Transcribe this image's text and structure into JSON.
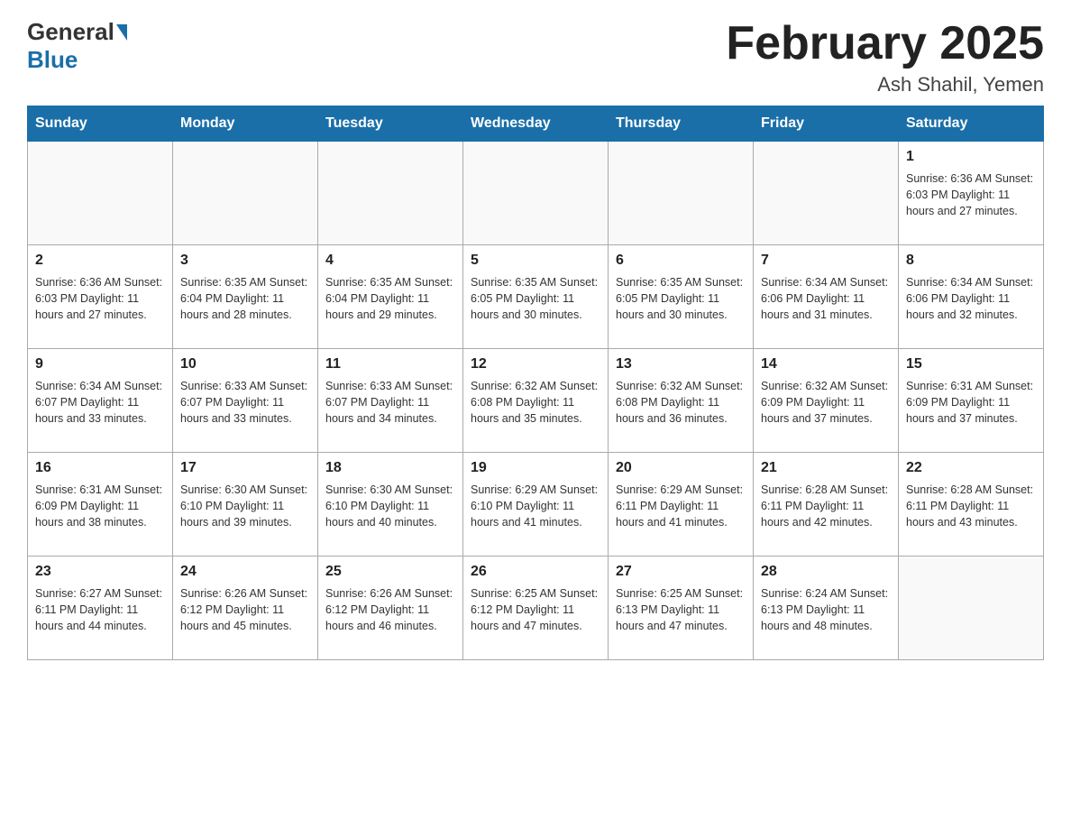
{
  "header": {
    "logo_general": "General",
    "logo_blue": "Blue",
    "month_title": "February 2025",
    "location": "Ash Shahil, Yemen"
  },
  "weekdays": [
    "Sunday",
    "Monday",
    "Tuesday",
    "Wednesday",
    "Thursday",
    "Friday",
    "Saturday"
  ],
  "weeks": [
    [
      {
        "day": "",
        "info": ""
      },
      {
        "day": "",
        "info": ""
      },
      {
        "day": "",
        "info": ""
      },
      {
        "day": "",
        "info": ""
      },
      {
        "day": "",
        "info": ""
      },
      {
        "day": "",
        "info": ""
      },
      {
        "day": "1",
        "info": "Sunrise: 6:36 AM\nSunset: 6:03 PM\nDaylight: 11 hours\nand 27 minutes."
      }
    ],
    [
      {
        "day": "2",
        "info": "Sunrise: 6:36 AM\nSunset: 6:03 PM\nDaylight: 11 hours\nand 27 minutes."
      },
      {
        "day": "3",
        "info": "Sunrise: 6:35 AM\nSunset: 6:04 PM\nDaylight: 11 hours\nand 28 minutes."
      },
      {
        "day": "4",
        "info": "Sunrise: 6:35 AM\nSunset: 6:04 PM\nDaylight: 11 hours\nand 29 minutes."
      },
      {
        "day": "5",
        "info": "Sunrise: 6:35 AM\nSunset: 6:05 PM\nDaylight: 11 hours\nand 30 minutes."
      },
      {
        "day": "6",
        "info": "Sunrise: 6:35 AM\nSunset: 6:05 PM\nDaylight: 11 hours\nand 30 minutes."
      },
      {
        "day": "7",
        "info": "Sunrise: 6:34 AM\nSunset: 6:06 PM\nDaylight: 11 hours\nand 31 minutes."
      },
      {
        "day": "8",
        "info": "Sunrise: 6:34 AM\nSunset: 6:06 PM\nDaylight: 11 hours\nand 32 minutes."
      }
    ],
    [
      {
        "day": "9",
        "info": "Sunrise: 6:34 AM\nSunset: 6:07 PM\nDaylight: 11 hours\nand 33 minutes."
      },
      {
        "day": "10",
        "info": "Sunrise: 6:33 AM\nSunset: 6:07 PM\nDaylight: 11 hours\nand 33 minutes."
      },
      {
        "day": "11",
        "info": "Sunrise: 6:33 AM\nSunset: 6:07 PM\nDaylight: 11 hours\nand 34 minutes."
      },
      {
        "day": "12",
        "info": "Sunrise: 6:32 AM\nSunset: 6:08 PM\nDaylight: 11 hours\nand 35 minutes."
      },
      {
        "day": "13",
        "info": "Sunrise: 6:32 AM\nSunset: 6:08 PM\nDaylight: 11 hours\nand 36 minutes."
      },
      {
        "day": "14",
        "info": "Sunrise: 6:32 AM\nSunset: 6:09 PM\nDaylight: 11 hours\nand 37 minutes."
      },
      {
        "day": "15",
        "info": "Sunrise: 6:31 AM\nSunset: 6:09 PM\nDaylight: 11 hours\nand 37 minutes."
      }
    ],
    [
      {
        "day": "16",
        "info": "Sunrise: 6:31 AM\nSunset: 6:09 PM\nDaylight: 11 hours\nand 38 minutes."
      },
      {
        "day": "17",
        "info": "Sunrise: 6:30 AM\nSunset: 6:10 PM\nDaylight: 11 hours\nand 39 minutes."
      },
      {
        "day": "18",
        "info": "Sunrise: 6:30 AM\nSunset: 6:10 PM\nDaylight: 11 hours\nand 40 minutes."
      },
      {
        "day": "19",
        "info": "Sunrise: 6:29 AM\nSunset: 6:10 PM\nDaylight: 11 hours\nand 41 minutes."
      },
      {
        "day": "20",
        "info": "Sunrise: 6:29 AM\nSunset: 6:11 PM\nDaylight: 11 hours\nand 41 minutes."
      },
      {
        "day": "21",
        "info": "Sunrise: 6:28 AM\nSunset: 6:11 PM\nDaylight: 11 hours\nand 42 minutes."
      },
      {
        "day": "22",
        "info": "Sunrise: 6:28 AM\nSunset: 6:11 PM\nDaylight: 11 hours\nand 43 minutes."
      }
    ],
    [
      {
        "day": "23",
        "info": "Sunrise: 6:27 AM\nSunset: 6:11 PM\nDaylight: 11 hours\nand 44 minutes."
      },
      {
        "day": "24",
        "info": "Sunrise: 6:26 AM\nSunset: 6:12 PM\nDaylight: 11 hours\nand 45 minutes."
      },
      {
        "day": "25",
        "info": "Sunrise: 6:26 AM\nSunset: 6:12 PM\nDaylight: 11 hours\nand 46 minutes."
      },
      {
        "day": "26",
        "info": "Sunrise: 6:25 AM\nSunset: 6:12 PM\nDaylight: 11 hours\nand 47 minutes."
      },
      {
        "day": "27",
        "info": "Sunrise: 6:25 AM\nSunset: 6:13 PM\nDaylight: 11 hours\nand 47 minutes."
      },
      {
        "day": "28",
        "info": "Sunrise: 6:24 AM\nSunset: 6:13 PM\nDaylight: 11 hours\nand 48 minutes."
      },
      {
        "day": "",
        "info": ""
      }
    ]
  ]
}
